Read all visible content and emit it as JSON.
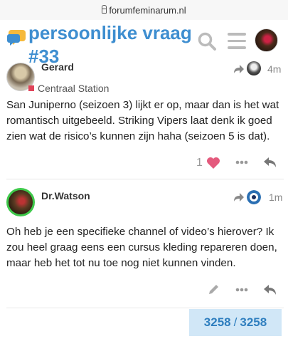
{
  "browser": {
    "domain": "forumfeminarum.nl"
  },
  "header": {
    "title": "persoonlijke vraag #33"
  },
  "posts": [
    {
      "username": "Gerard",
      "badge": "Centraal Station",
      "time": "4m",
      "body": "San Juniperno (seizoen 3) lijkt er op, maar dan is het wat romantisch uitgebeeld. Striking Vipers laat denk ik goed zien wat de risico’s kunnen zijn haha (seizoen 5 is dat).",
      "like_count": "1"
    },
    {
      "username": "Dr.Watson",
      "time": "1m",
      "body": "Oh heb je een specifieke channel of video’s hierover? Ik zou heel graag eens een cursus kleding repareren doen, maar heb het tot nu toe nog niet kunnen vinden."
    }
  ],
  "progress": {
    "current": "3258",
    "separator": "/",
    "total": "3258"
  },
  "colors": {
    "accent": "#3e8ed0",
    "like": "#e45a7d",
    "progress_bg": "#d1e7f7",
    "online": "#3ec84a"
  },
  "icons": [
    "lock-icon",
    "forum-logo-icon",
    "search-icon",
    "hamburger-menu-icon",
    "reply-arrow-icon",
    "heart-icon",
    "more-dots-icon",
    "reply-icon",
    "edit-pencil-icon"
  ]
}
